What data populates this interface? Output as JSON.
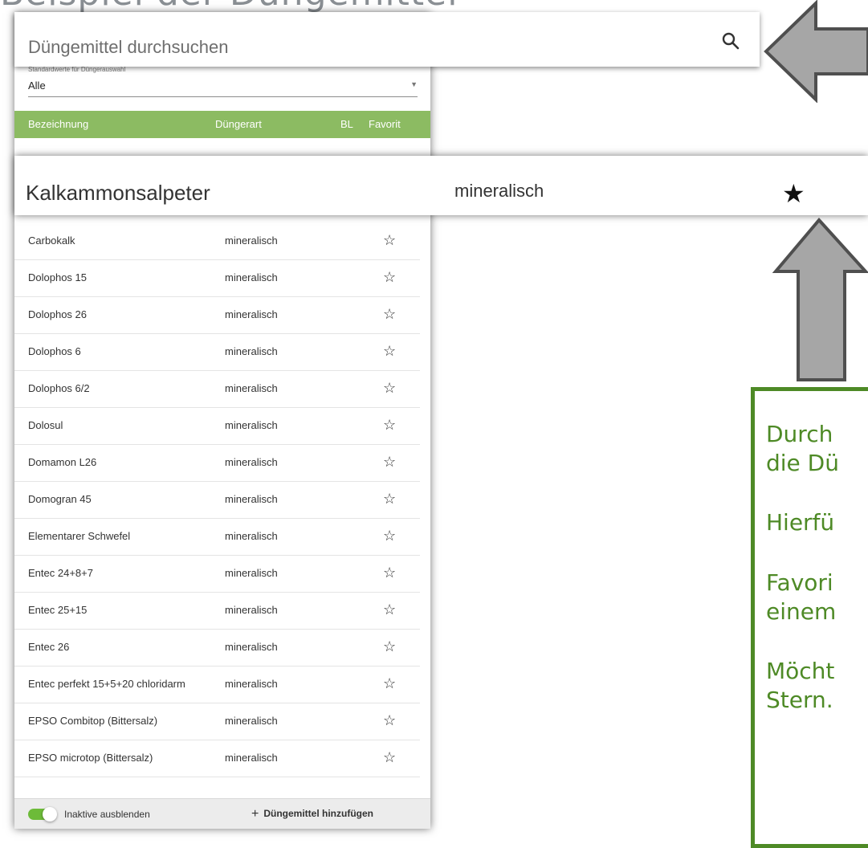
{
  "slide": {
    "title": "Beispiel der Düngemittel"
  },
  "search": {
    "placeholder": "Düngemittel durchsuchen"
  },
  "filter": {
    "label": "Standardwerte für Düngerauswahl",
    "value": "Alle"
  },
  "table": {
    "headers": {
      "name": "Bezeichnung",
      "type": "Düngerart",
      "bl": "BL",
      "favorite": "Favorit"
    },
    "rows": [
      {
        "name": "Carbokalk",
        "type": "mineralisch",
        "favorite": false
      },
      {
        "name": "Dolophos 15",
        "type": "mineralisch",
        "favorite": false
      },
      {
        "name": "Dolophos 26",
        "type": "mineralisch",
        "favorite": false
      },
      {
        "name": "Dolophos 6",
        "type": "mineralisch",
        "favorite": false
      },
      {
        "name": "Dolophos 6/2",
        "type": "mineralisch",
        "favorite": false
      },
      {
        "name": "Dolosul",
        "type": "mineralisch",
        "favorite": false
      },
      {
        "name": "Domamon L26",
        "type": "mineralisch",
        "favorite": false
      },
      {
        "name": "Domogran 45",
        "type": "mineralisch",
        "favorite": false
      },
      {
        "name": "Elementarer Schwefel",
        "type": "mineralisch",
        "favorite": false
      },
      {
        "name": "Entec 24+8+7",
        "type": "mineralisch",
        "favorite": false
      },
      {
        "name": "Entec 25+15",
        "type": "mineralisch",
        "favorite": false
      },
      {
        "name": "Entec 26",
        "type": "mineralisch",
        "favorite": false
      },
      {
        "name": "Entec perfekt 15+5+20 chloridarm",
        "type": "mineralisch",
        "favorite": false
      },
      {
        "name": "EPSO Combitop (Bittersalz)",
        "type": "mineralisch",
        "favorite": false
      },
      {
        "name": "EPSO microtop (Bittersalz)",
        "type": "mineralisch",
        "favorite": false
      }
    ]
  },
  "highlight_row": {
    "name": "Kalkammonsalpeter",
    "type": "mineralisch",
    "favorite": true
  },
  "footer": {
    "toggle_label": "Inaktive ausblenden",
    "toggle_on": true,
    "add_label": "Düngemittel hinzufügen"
  },
  "info_box": {
    "line1": "Durch",
    "line2": "die Dü",
    "line3": "Hierfü",
    "line4": "Favori",
    "line5": "einem",
    "line6": "Möcht",
    "line7": "Stern."
  },
  "colors": {
    "header_green": "#8cbb62",
    "toggle_green": "#6dbb39",
    "info_green": "#4e8a26",
    "arrow_gray": "#a6a6a6"
  }
}
